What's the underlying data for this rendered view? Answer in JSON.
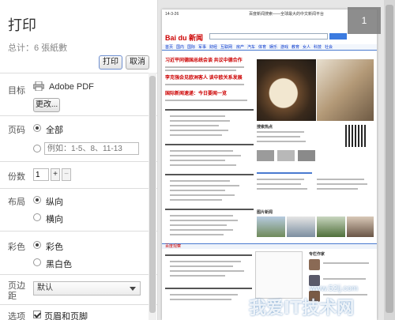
{
  "header": {
    "title": "打印",
    "total": "总计：6 張紙數"
  },
  "actions": {
    "print": "打印",
    "cancel": "取消"
  },
  "destination": {
    "label": "目标",
    "printer": "Adobe PDF",
    "change": "更改..."
  },
  "pages": {
    "label": "页码",
    "all": "全部",
    "range_placeholder": "例如：1-5、8、11-13"
  },
  "copies": {
    "label": "份数",
    "value": "1",
    "plus": "+",
    "minus": "−"
  },
  "layout": {
    "label": "布局",
    "portrait": "纵向",
    "landscape": "横向"
  },
  "color": {
    "label": "彩色",
    "color": "彩色",
    "bw": "黑白色"
  },
  "margins": {
    "label": "页边距",
    "value": "默认"
  },
  "options": {
    "label": "选项",
    "headers_footers": "页眉和页脚"
  },
  "preview": {
    "page_number": "1",
    "date": "14-3-26",
    "site_title": "百度新闻搜索——全球最大的中文新闻平台",
    "logo": "Bai du 新闻",
    "nav": [
      "首页",
      "国内",
      "国际",
      "军事",
      "财经",
      "互联网",
      "房产",
      "汽车",
      "体育",
      "娱乐",
      "游戏",
      "教育",
      "女人",
      "科技",
      "社会"
    ],
    "headlines": [
      "习近平同德国总统会谈 共议中德合作",
      "李克强会见欧洲客人 谈中欧关系发展",
      "国际新闻速递：今日要闻一览"
    ],
    "section_1": "搜索热点",
    "section_2": "图片新闻",
    "section_3": "百度观察",
    "section_4": "专栏作家",
    "watermark": "我爱IT技术网",
    "watermark_sub": "www.52ij.com"
  }
}
